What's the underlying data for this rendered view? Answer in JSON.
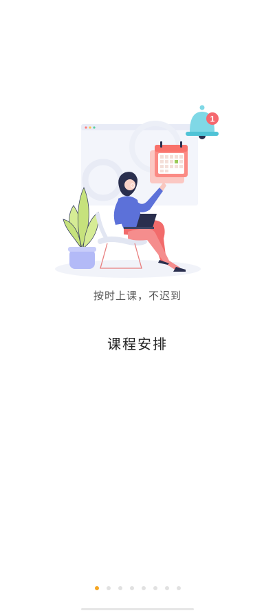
{
  "onboarding": {
    "subtitle": "按时上课，不迟到",
    "title": "课程安排",
    "notification_badge": "1",
    "page_count": 8,
    "current_page": 1
  },
  "colors": {
    "accent": "#f5a623",
    "dot_inactive": "#e1e1e1"
  }
}
